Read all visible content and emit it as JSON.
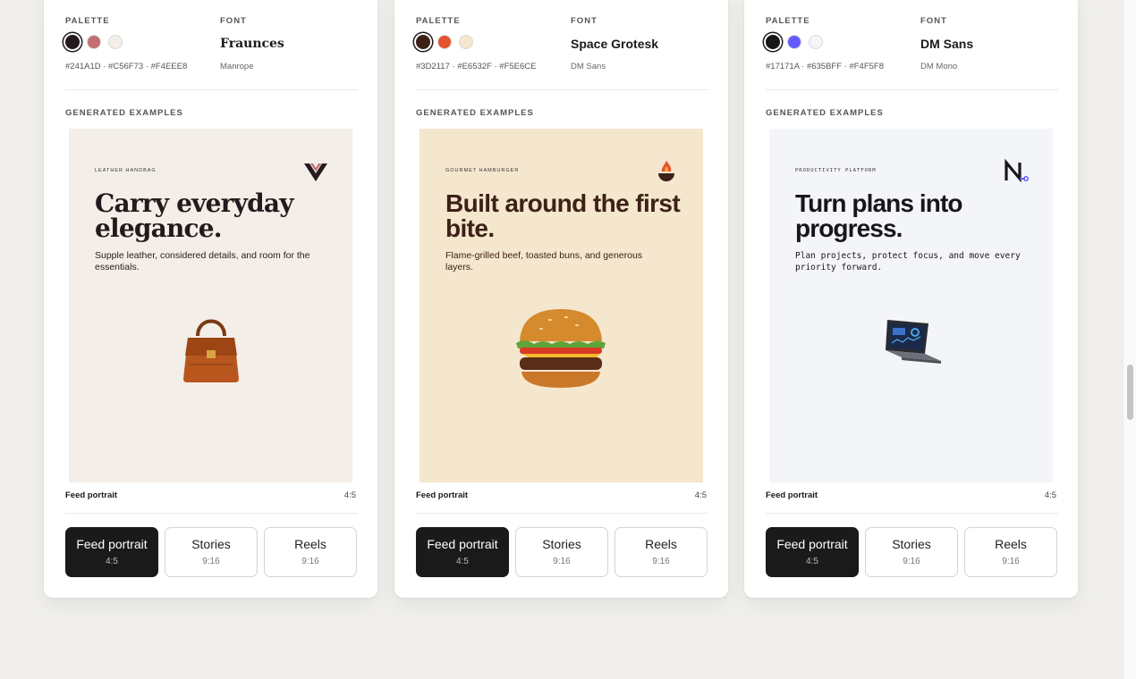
{
  "labels": {
    "palette": "PALETTE",
    "font": "FONT",
    "generated_examples": "GENERATED EXAMPLES"
  },
  "cards": [
    {
      "palette": {
        "colors": [
          "#241A1D",
          "#C56F73",
          "#F4EEE8"
        ],
        "hex_text": "#241A1D · #C56F73 · #F4EEE8"
      },
      "font": {
        "name": "Fraunces",
        "secondary": "Manrope"
      },
      "preview": {
        "bg": "#F4EEE8",
        "category": "LEATHER HANDBAG",
        "headline": "Carry everyday elegance.",
        "body": "Supple leather, considered details, and room for the essentials.",
        "logo_icon": "v-chevron-logo-icon",
        "product_icon": "handbag-icon"
      },
      "format_label": "Feed portrait",
      "format_ratio": "4:5"
    },
    {
      "palette": {
        "colors": [
          "#3D2117",
          "#E6532F",
          "#F5E6CE"
        ],
        "hex_text": "#3D2117 · #E6532F · #F5E6CE"
      },
      "font": {
        "name": "Space Grotesk",
        "secondary": "DM Sans"
      },
      "preview": {
        "bg": "#F5E6CE",
        "category": "GOURMET HAMBURGER",
        "headline": "Built around the first bite.",
        "body": "Flame-grilled beef, toasted buns, and generous layers.",
        "logo_icon": "flame-logo-icon",
        "product_icon": "burger-icon"
      },
      "format_label": "Feed portrait",
      "format_ratio": "4:5"
    },
    {
      "palette": {
        "colors": [
          "#17171A",
          "#635BFF",
          "#F4F5F8"
        ],
        "hex_text": "#17171A · #635BFF · #F4F5F8"
      },
      "font": {
        "name": "DM Sans",
        "secondary": "DM Mono"
      },
      "preview": {
        "bg": "#F4F5F8",
        "category": "PRODUCTIVITY PLATFORM",
        "headline": "Turn plans into progress.",
        "body": "Plan projects, protect focus, and move every priority forward.",
        "logo_icon": "n-mark-logo-icon",
        "product_icon": "laptop-icon"
      },
      "format_label": "Feed portrait",
      "format_ratio": "4:5"
    }
  ],
  "formats": [
    {
      "name": "Feed portrait",
      "ratio": "4:5",
      "active": true
    },
    {
      "name": "Stories",
      "ratio": "9:16",
      "active": false
    },
    {
      "name": "Reels",
      "ratio": "9:16",
      "active": false
    }
  ]
}
